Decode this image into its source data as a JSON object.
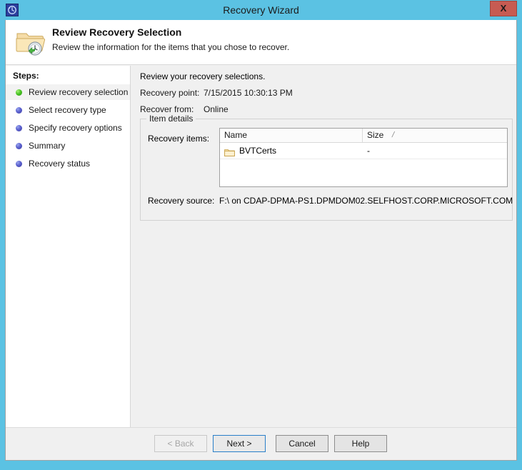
{
  "window": {
    "title": "Recovery Wizard",
    "icon": "recovery-clock-icon",
    "close_label": "X",
    "accent_color": "#5bc2e3",
    "close_color": "#c75b52"
  },
  "banner": {
    "icon": "folder-recovery-icon",
    "title": "Review Recovery Selection",
    "subtitle": "Review the information for the items that you chose to recover."
  },
  "sidebar": {
    "heading": "Steps:",
    "items": [
      {
        "label": "Review recovery selection",
        "state": "current",
        "bullet": "green"
      },
      {
        "label": "Select recovery type",
        "state": "pending",
        "bullet": "blue"
      },
      {
        "label": "Specify recovery options",
        "state": "pending",
        "bullet": "blue"
      },
      {
        "label": "Summary",
        "state": "pending",
        "bullet": "blue"
      },
      {
        "label": "Recovery status",
        "state": "pending",
        "bullet": "blue"
      }
    ]
  },
  "main": {
    "intro": "Review your recovery selections.",
    "recovery_point_label": "Recovery point:",
    "recovery_point_value": "7/15/2015 10:30:13 PM",
    "recover_from_label": "Recover from:",
    "recover_from_value": "Online",
    "group_title": "Item details",
    "recovery_items_label": "Recovery items:",
    "recovery_source_label": "Recovery source:",
    "recovery_source_value": "F:\\ on CDAP-DPMA-PS1.DPMDOM02.SELFHOST.CORP.MICROSOFT.COM",
    "table": {
      "columns": [
        "Name",
        "Size"
      ],
      "sort_indicator": "/",
      "rows": [
        {
          "icon": "folder-icon",
          "name": "BVTCerts",
          "size": "-"
        }
      ]
    }
  },
  "footer": {
    "buttons": [
      {
        "label": "< Back",
        "state": "disabled"
      },
      {
        "label": "Next >",
        "state": "default"
      },
      {
        "label": "Cancel",
        "state": "normal"
      },
      {
        "label": "Help",
        "state": "normal"
      }
    ]
  }
}
